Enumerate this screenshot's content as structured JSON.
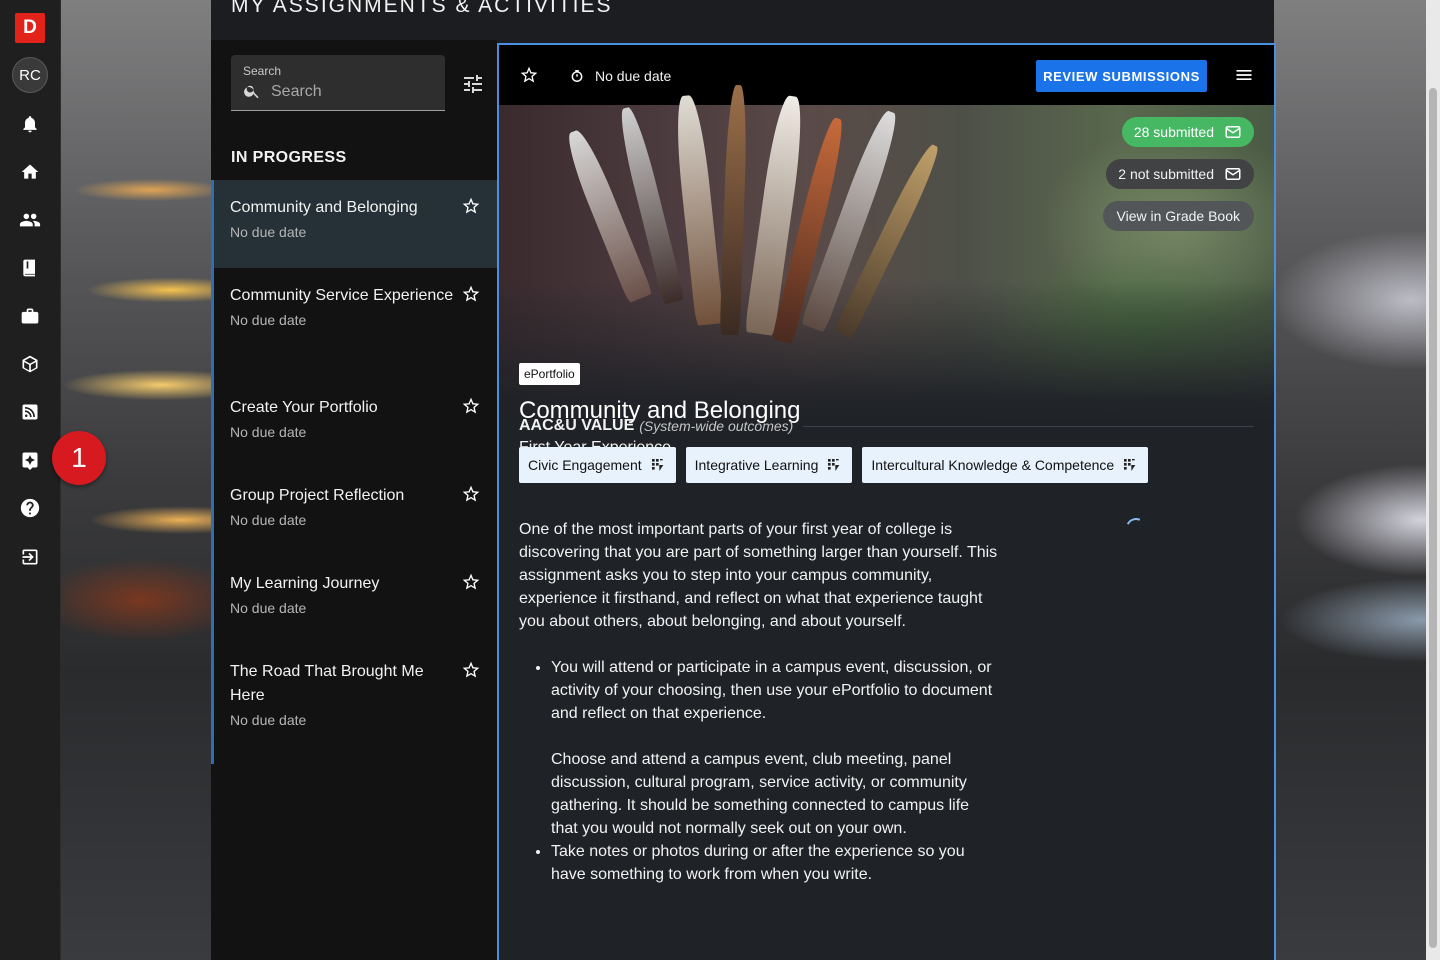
{
  "page": {
    "title": "MY ASSIGNMENTS & ACTIVITIES"
  },
  "rail": {
    "logo_letter": "D",
    "avatar_initials": "RC",
    "badge_count": "1",
    "icons": [
      "bell-icon",
      "home-icon",
      "people-icon",
      "book-icon",
      "briefcase-icon",
      "cube-icon",
      "rss-icon",
      "rubric-icon",
      "help-icon",
      "logout-icon"
    ]
  },
  "search": {
    "label": "Search",
    "placeholder": "Search",
    "value": ""
  },
  "list": {
    "header": "IN PROGRESS",
    "items": [
      {
        "title": "Community and Belonging",
        "date": "No due date"
      },
      {
        "title": "Community Service Experience",
        "date": "No due date"
      },
      {
        "title": "Create Your Portfolio",
        "date": "No due date"
      },
      {
        "title": "Group Project Reflection",
        "date": "No due date"
      },
      {
        "title": "My Learning Journey",
        "date": "No due date"
      },
      {
        "title": "The Road That Brought Me Here",
        "date": "No due date"
      }
    ]
  },
  "detail": {
    "due": "No due date",
    "review_label": "REVIEW SUBMISSIONS",
    "submitted": "28 submitted",
    "not_submitted": "2 not submitted",
    "gradebook": "View in Grade Book",
    "tag": "ePortfolio",
    "title": "Community and Belonging",
    "subtitle": "First Year Experience",
    "aac_title": "AAC&U VALUE",
    "aac_sub": "(System-wide outcomes)",
    "outcomes": [
      "Civic Engagement",
      "Integrative Learning",
      "Intercultural Knowledge & Competence"
    ],
    "intro": "One of the most important parts of your first year of college is discovering that you are part of something larger than yourself. This assignment asks you to step into your campus community, experience it firsthand, and reflect on what that experience taught you about others, about belonging, and about yourself.",
    "bullet1_a": "You will attend or participate in a campus event, discussion, or activity of your choosing, then use your ePortfolio to document and reflect on that experience.",
    "bullet1_b": "Choose and attend a campus event, club meeting, panel discussion, cultural program, service activity, or community gathering. It should be something connected to campus life that you would not normally seek out on your own.",
    "bullet2": "Take notes or photos during or after the experience so you have something to work from when you write."
  },
  "colors": {
    "accent": "#1a73e8",
    "submitted_green": "#46b863",
    "logo_red": "#e2231a",
    "badge_red": "#d71920",
    "active_row": "#253037",
    "selection_border": "#4a8fe0"
  }
}
